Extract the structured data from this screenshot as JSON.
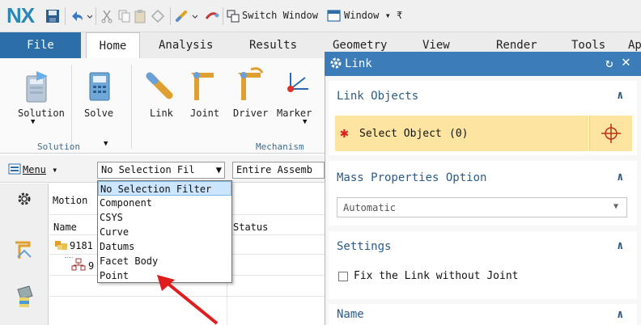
{
  "titlebar": {
    "logo": "NX",
    "switch_window": "Switch Window",
    "window_menu": "Window",
    "icons": [
      "save-icon",
      "undo-icon",
      "cut-icon",
      "copy-icon",
      "paste-icon",
      "repeat-icon",
      "selection-icon",
      "link-tool-icon",
      "switch-window-icon",
      "window-icon"
    ]
  },
  "tabs": [
    "File",
    "Home",
    "Analysis",
    "Results",
    "Geometry",
    "View",
    "Render",
    "Tools",
    "Ap"
  ],
  "ribbon": {
    "buttons": [
      "Solution",
      "Solve",
      "Link",
      "Joint",
      "Driver",
      "Marker"
    ],
    "groups": [
      "Solution",
      "Mechanism"
    ]
  },
  "selbar": {
    "menu": "Menu",
    "filter_value": "No Selection Fil",
    "scope_value": "Entire Assemb"
  },
  "navigator": {
    "title": "Motion",
    "col_name": "Name",
    "col_status": "Status",
    "row1": "9181",
    "row2": "9"
  },
  "dropdown": {
    "items": [
      "No Selection Filter",
      "Component",
      "CSYS",
      "Curve",
      "Datums",
      "Facet Body",
      "Point"
    ]
  },
  "dialog": {
    "title": "Link",
    "link_objects": "Link Objects",
    "select_object": "Select Object",
    "select_count": "(0)",
    "mass_properties": "Mass Properties Option",
    "mass_value": "Automatic",
    "settings": "Settings",
    "fix_link": "Fix the Link without Joint",
    "name": "Name",
    "colors": {
      "header": "#3c7cb8",
      "highlight": "#fde5a1",
      "required": "#e02020"
    }
  },
  "annotation": {
    "arrow_color": "#e01c1c"
  }
}
